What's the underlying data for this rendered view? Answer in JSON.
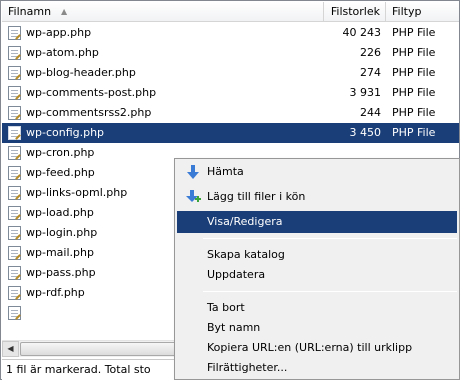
{
  "columns": {
    "name": "Filnamn",
    "size": "Filstorlek",
    "type": "Filtyp"
  },
  "files": [
    {
      "name": "wp-app.php",
      "size": "40 243",
      "type": "PHP File"
    },
    {
      "name": "wp-atom.php",
      "size": "226",
      "type": "PHP File"
    },
    {
      "name": "wp-blog-header.php",
      "size": "274",
      "type": "PHP File"
    },
    {
      "name": "wp-comments-post.php",
      "size": "3 931",
      "type": "PHP File"
    },
    {
      "name": "wp-commentsrss2.php",
      "size": "244",
      "type": "PHP File"
    },
    {
      "name": "wp-config.php",
      "size": "3 450",
      "type": "PHP File"
    },
    {
      "name": "wp-cron.php",
      "size": "",
      "type": ""
    },
    {
      "name": "wp-feed.php",
      "size": "",
      "type": ""
    },
    {
      "name": "wp-links-opml.php",
      "size": "",
      "type": ""
    },
    {
      "name": "wp-load.php",
      "size": "",
      "type": ""
    },
    {
      "name": "wp-login.php",
      "size": "",
      "type": ""
    },
    {
      "name": "wp-mail.php",
      "size": "",
      "type": ""
    },
    {
      "name": "wp-pass.php",
      "size": "",
      "type": ""
    },
    {
      "name": "wp-rdf.php",
      "size": "",
      "type": ""
    }
  ],
  "selected_index": 5,
  "status_text": "1 fil är markerad. Total sto",
  "context_menu": {
    "download": "Hämta",
    "add_to_queue": "Lägg till filer i kön",
    "view_edit": "Visa/Redigera",
    "create_directory": "Skapa katalog",
    "refresh": "Uppdatera",
    "delete": "Ta bort",
    "rename": "Byt namn",
    "copy_url": "Kopiera URL:en (URL:erna) till urklipp",
    "file_permissions": "Filrättigheter..."
  },
  "icons": {
    "file": "php-file-icon",
    "sort": "sort-ascending-icon",
    "download": "download-arrow-icon",
    "queue": "add-to-queue-icon"
  },
  "colors": {
    "selection": "#1a3e78",
    "menu_background": "#f0f0f0",
    "download_arrow": "#3a7bd5",
    "queue_plus": "#3aa53a"
  }
}
